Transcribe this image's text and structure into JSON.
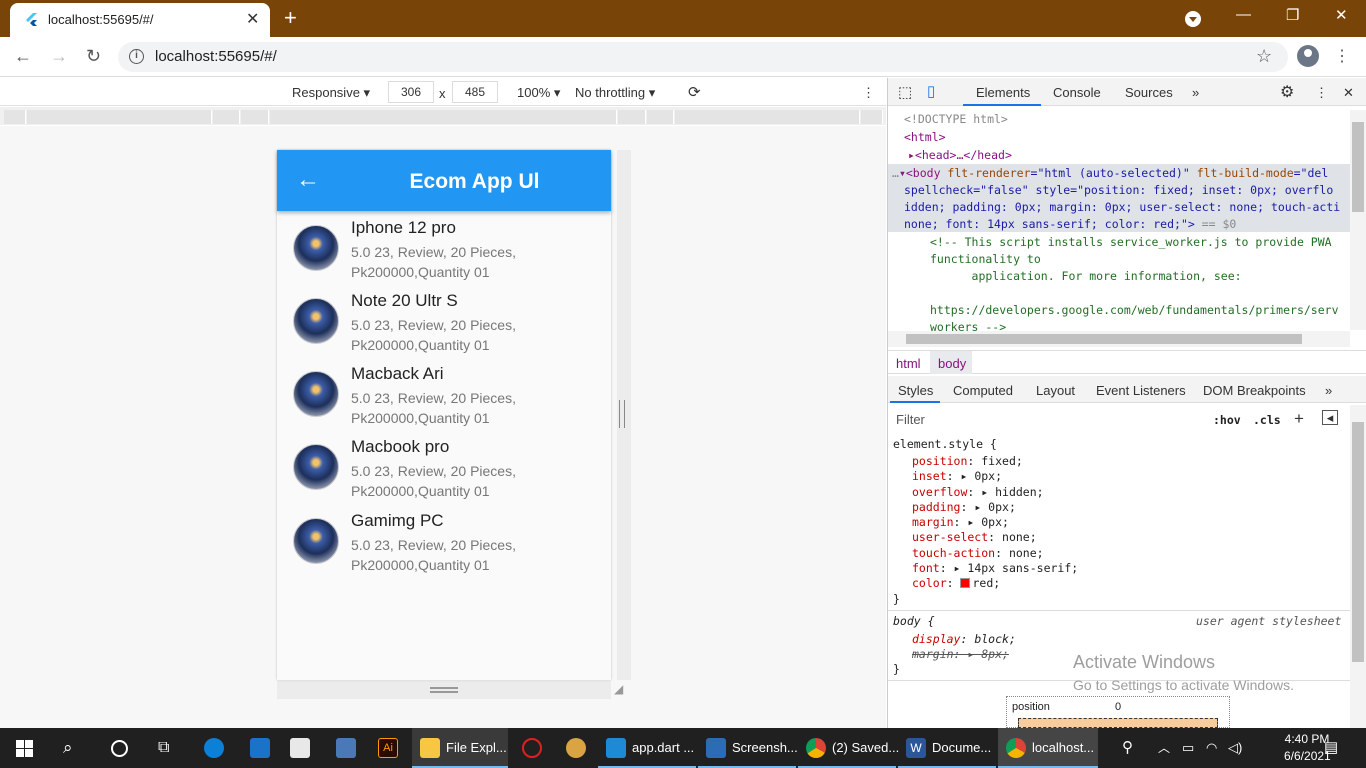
{
  "browser": {
    "tab_title": "localhost:55695/#/",
    "url": "localhost:55695/#/",
    "colors": {
      "titlebar": "#784408"
    }
  },
  "device_toolbar": {
    "mode": "Responsive",
    "width": "306",
    "x": "x",
    "height": "485",
    "zoom": "100%",
    "throttling": "No throttling"
  },
  "app": {
    "title": "Ecom App Ul",
    "accent": "#2196f3",
    "items": [
      {
        "name": "Iphone 12 pro",
        "line1": "5.0 23, Review, 20 Pieces,",
        "line2": "Pk200000,Quantity 01"
      },
      {
        "name": "Note 20 Ultr S",
        "line1": "5.0 23, Review, 20 Pieces,",
        "line2": "Pk200000,Quantity 01"
      },
      {
        "name": "Macback Ari",
        "line1": "5.0 23, Review, 20 Pieces,",
        "line2": "Pk200000,Quantity 01"
      },
      {
        "name": "Macbook pro",
        "line1": "5.0 23, Review, 20 Pieces,",
        "line2": "Pk200000,Quantity 01"
      },
      {
        "name": "Gamimg PC",
        "line1": "5.0 23, Review, 20 Pieces,",
        "line2": "Pk200000,Quantity 01"
      }
    ]
  },
  "devtools": {
    "tabs": [
      "Elements",
      "Console",
      "Sources",
      "»"
    ],
    "dom": {
      "doctype": "<!DOCTYPE html>",
      "html_open": "<html>",
      "head": "<head>…</head>",
      "body_l1a": "<body ",
      "body_l1b": "flt-renderer",
      "body_l1c": "=\"html (auto-selected)\" ",
      "body_l1d": "flt-build-mode",
      "body_l1e": "=\"del",
      "body_l2": "spellcheck=\"false\" style=\"position: fixed; inset: 0px; overflo",
      "body_l3": "idden; padding: 0px; margin: 0px; user-select: none; touch-acti",
      "body_l4a": "none; font: 14px sans-serif; color: red;\">",
      "body_l4b": " == $0",
      "cmt1": "<!-- This script installs service_worker.js to provide PWA",
      "cmt2": "functionality to",
      "cmt3": "      application. For more information, see:",
      "cmt4": "https://developers.google.com/web/fundamentals/primers/serv",
      "cmt5": "workers -->"
    },
    "breadcrumbs": [
      "html",
      "body"
    ],
    "styles_tabs": [
      "Styles",
      "Computed",
      "Layout",
      "Event Listeners",
      "DOM Breakpoints",
      "»"
    ],
    "filter_placeholder": "Filter",
    "hov": ":hov",
    "cls": ".cls",
    "element_style": {
      "selector": "element.style {",
      "rules": [
        {
          "p": "position",
          "v": "fixed;"
        },
        {
          "p": "inset",
          "v": "0px;"
        },
        {
          "p": "overflow",
          "v": "hidden;"
        },
        {
          "p": "padding",
          "v": "0px;"
        },
        {
          "p": "margin",
          "v": "0px;"
        },
        {
          "p": "user-select",
          "v": "none;"
        },
        {
          "p": "touch-action",
          "v": "none;"
        },
        {
          "p": "font",
          "v": "14px sans-serif;"
        },
        {
          "p": "color",
          "v": "red;"
        }
      ],
      "close": "}"
    },
    "body_rule": {
      "selector": "body {",
      "source": "user agent stylesheet",
      "display": "display",
      "display_v": "block;",
      "margin": "margin",
      "margin_v": "8px;",
      "close": "}"
    },
    "box_label": "position",
    "box_value": "0"
  },
  "watermark": {
    "line1": "Activate Windows",
    "line2": "Go to Settings to activate Windows."
  },
  "taskbar": {
    "items": [
      "File Expl...",
      "app.dart ...",
      "Screensh...",
      "(2) Saved...",
      "Docume...",
      "localhost..."
    ],
    "time": "4:40 PM",
    "date": "6/6/2021"
  }
}
